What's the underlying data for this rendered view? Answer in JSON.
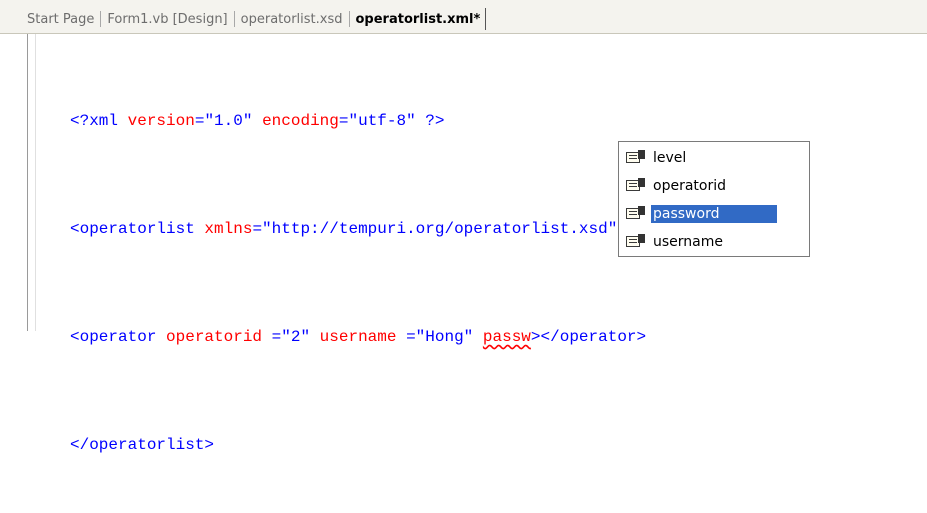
{
  "tabs": [
    {
      "label": "Start Page",
      "active": false
    },
    {
      "label": "Form1.vb [Design]",
      "active": false
    },
    {
      "label": "operatorlist.xsd",
      "active": false
    },
    {
      "label": "operatorlist.xml*",
      "active": true
    }
  ],
  "code": {
    "line1": {
      "open": "<?xml ",
      "attr1": "version",
      "eq1": "=",
      "val1": "\"1.0\"",
      "space1": " ",
      "attr2": "encoding",
      "eq2": "=",
      "val2": "\"utf-8\"",
      "close": " ?>"
    },
    "line2": {
      "open": "<operatorlist ",
      "attr1": "xmlns",
      "eq1": "=",
      "val1": "\"http://tempuri.org/operatorlist.xsd\"",
      "close": ">"
    },
    "line3": {
      "open": "<operator ",
      "attr1": "operatorid",
      "eq1": " =",
      "val1": "\"2\"",
      "space1": " ",
      "attr2": "username",
      "eq2": " =",
      "val2": "\"Hong\"",
      "space2": " ",
      "typing": "passw",
      "close": "></operator>"
    },
    "line4": {
      "close_tag": "</operatorlist>"
    }
  },
  "intellisense": {
    "items": [
      {
        "label": "level",
        "icon": "property-icon",
        "selected": false
      },
      {
        "label": "operatorid",
        "icon": "property-icon",
        "selected": false
      },
      {
        "label": "password",
        "icon": "property-icon",
        "selected": true
      },
      {
        "label": "username",
        "icon": "property-icon",
        "selected": false
      }
    ],
    "selection_color": "#316ac5"
  },
  "colors": {
    "tag": "#0000ff",
    "element_name": "#a31515",
    "attribute": "#ff0000",
    "tab_bar": "#f4f3ee"
  }
}
